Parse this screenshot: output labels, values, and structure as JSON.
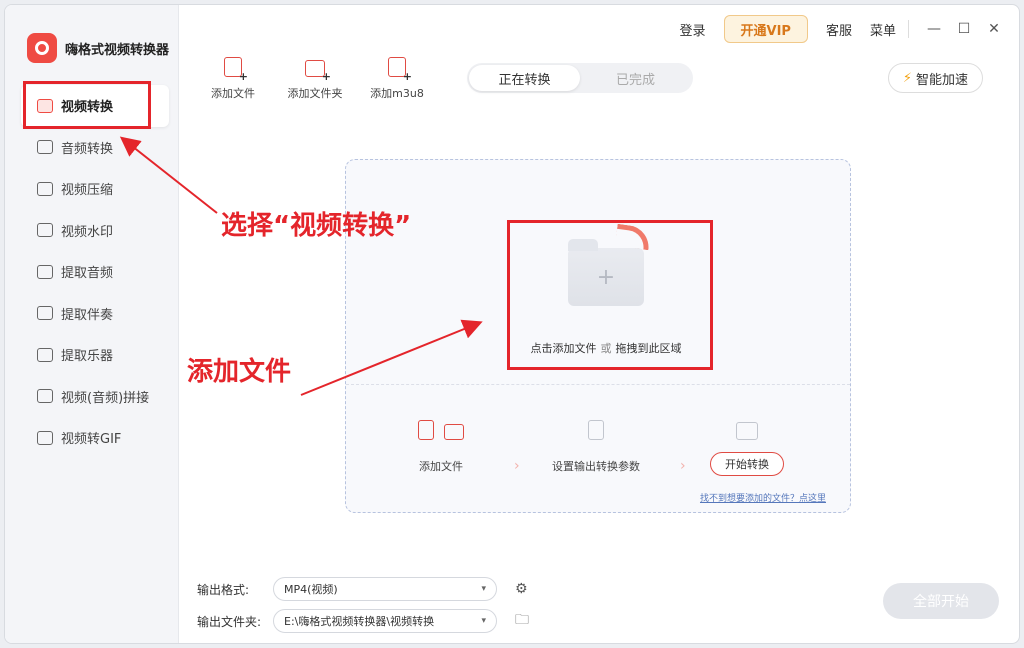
{
  "app": {
    "title": "嗨格式视频转换器"
  },
  "header": {
    "login": "登录",
    "vip": "开通VIP",
    "service": "客服",
    "menu": "菜单",
    "minimize": "—",
    "maximize": "☐",
    "close": "✕"
  },
  "sidebar": {
    "items": [
      {
        "label": "视频转换",
        "icon": "video-convert-icon"
      },
      {
        "label": "音频转换",
        "icon": "audio-convert-icon"
      },
      {
        "label": "视频压缩",
        "icon": "video-compress-icon"
      },
      {
        "label": "视频水印",
        "icon": "watermark-icon"
      },
      {
        "label": "提取音频",
        "icon": "extract-audio-icon"
      },
      {
        "label": "提取伴奏",
        "icon": "extract-accompaniment-icon"
      },
      {
        "label": "提取乐器",
        "icon": "guitar-icon"
      },
      {
        "label": "视频(音频)拼接",
        "icon": "merge-icon"
      },
      {
        "label": "视频转GIF",
        "icon": "gif-icon"
      }
    ]
  },
  "toolbar": {
    "add_file": "添加文件",
    "add_folder": "添加文件夹",
    "add_m3u8": "添加m3u8"
  },
  "tabs": {
    "converting": "正在转换",
    "done": "已完成"
  },
  "speed": {
    "label": "智能加速",
    "icon": "⚡"
  },
  "dropzone": {
    "click_add": "点击添加文件",
    "or": "或",
    "drag": "拖拽到此区域",
    "plus": "+"
  },
  "steps": {
    "add_file": "添加文件",
    "set_params": "设置输出转换参数",
    "start": "开始转换",
    "chevron": "›",
    "help": "找不到想要添加的文件？点这里"
  },
  "annotations": {
    "select": "选择“视频转换”",
    "add": "添加文件"
  },
  "output": {
    "format_label": "输出格式:",
    "format_value": "MP4(视频)",
    "folder_label": "输出文件夹:",
    "folder_value": "E:\\嗨格式视频转换器\\视频转换",
    "caret": "▾",
    "gear": "⚙",
    "folder_icon": "🗀"
  },
  "all_start": "全部开始",
  "colors": {
    "accent": "#e04b43",
    "highlight": "#e4252b",
    "vip": "#d8781b"
  }
}
